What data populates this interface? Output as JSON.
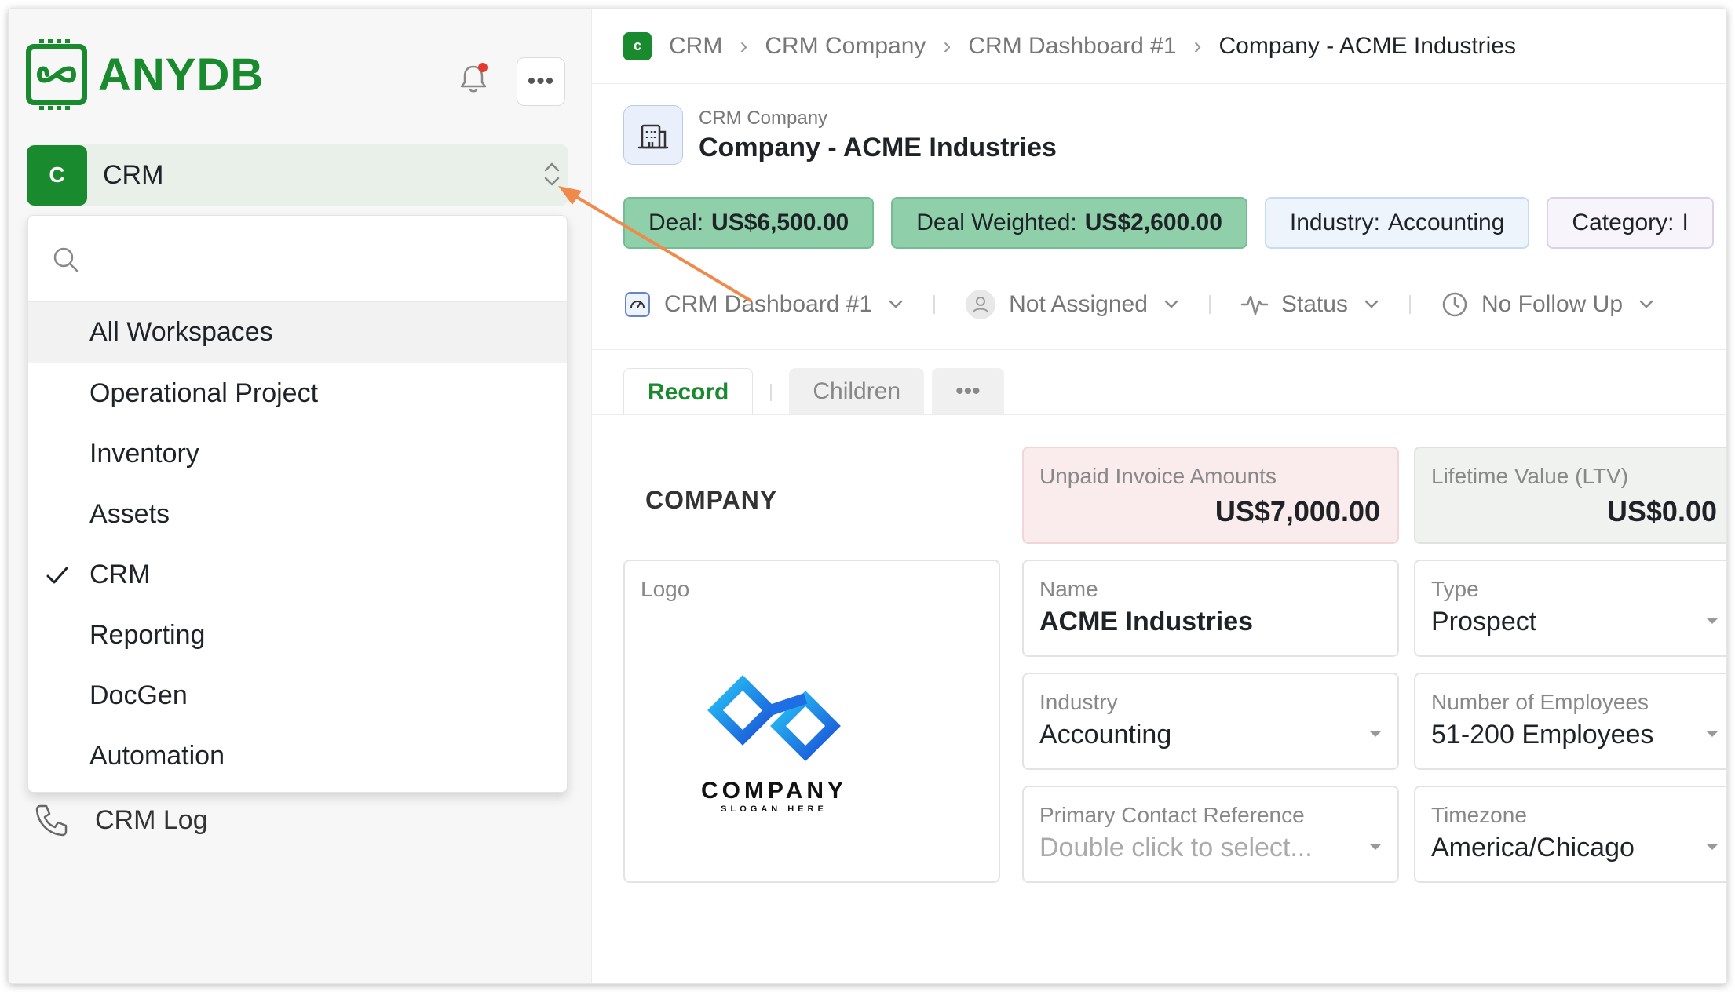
{
  "sidebar": {
    "brand": "ANYDB",
    "workspace": {
      "initial": "C",
      "name": "CRM"
    },
    "dropdown": {
      "search_placeholder": "",
      "items": [
        {
          "label": "All Workspaces"
        },
        {
          "label": "Operational Project"
        },
        {
          "label": "Inventory"
        },
        {
          "label": "Assets"
        },
        {
          "label": "CRM",
          "checked": true
        },
        {
          "label": "Reporting"
        },
        {
          "label": "DocGen"
        },
        {
          "label": "Automation"
        }
      ]
    },
    "crm_log": "CRM Log"
  },
  "breadcrumb": {
    "badge": "c",
    "items": [
      "CRM",
      "CRM Company",
      "CRM Dashboard #1",
      "Company - ACME Industries"
    ]
  },
  "record": {
    "type": "CRM Company",
    "title": "Company - ACME Industries"
  },
  "chips": [
    {
      "label": "Deal:",
      "value": "US$6,500.00"
    },
    {
      "label": "Deal Weighted:",
      "value": "US$2,600.00"
    },
    {
      "label": "Industry:",
      "value": "Accounting"
    },
    {
      "label": "Category:",
      "value": "I"
    }
  ],
  "properties": {
    "dashboard": "CRM Dashboard #1",
    "assignee": "Not Assigned",
    "status": "Status",
    "follow_up": "No Follow Up"
  },
  "tabs": {
    "record": "Record",
    "children": "Children",
    "more": "•••"
  },
  "section": "COMPANY",
  "metrics": {
    "unpaid": {
      "label": "Unpaid Invoice Amounts",
      "value": "US$7,000.00"
    },
    "ltv": {
      "label": "Lifetime Value (LTV)",
      "value": "US$0.00"
    }
  },
  "fields": {
    "logo": {
      "label": "Logo",
      "company": "COMPANY",
      "slogan": "SLOGAN HERE"
    },
    "name": {
      "label": "Name",
      "value": "ACME Industries"
    },
    "type": {
      "label": "Type",
      "value": "Prospect"
    },
    "industry": {
      "label": "Industry",
      "value": "Accounting"
    },
    "employees": {
      "label": "Number of Employees",
      "value": "51-200 Employees"
    },
    "primary_contact": {
      "label": "Primary Contact Reference",
      "placeholder": "Double click to select..."
    },
    "timezone": {
      "label": "Timezone",
      "value": "America/Chicago"
    }
  },
  "colors": {
    "brand_green": "#1a8a2e",
    "chip_green": "#8fd0aa",
    "chip_blue": "#eef4fc",
    "unpaid_bg": "#faecec",
    "annotation_arrow": "#f08a4b"
  }
}
